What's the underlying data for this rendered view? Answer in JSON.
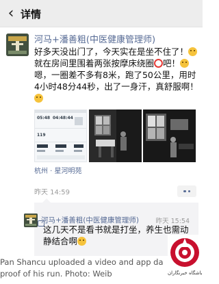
{
  "header": {
    "back_glyph": "‹",
    "title": "详情"
  },
  "post": {
    "author": "河马+潘善粗(中医健康管理师)",
    "text_1": "好多天没出门了，今天实在是坐不住了！",
    "text_2": "就在房间里围着两张按摩床绕圈",
    "text_3": "吧！",
    "text_4": "嗯，一圈差不多有8米，跑了50公里，用时4小时48分44秒，出了一身汗，真舒服啊！",
    "location": "杭州 · 星河明苑",
    "time": "昨天 14:59",
    "app_screenshot": {
      "stat_1": "05:48",
      "stat_2": "04:48:44",
      "stat_3": "119"
    }
  },
  "comment": {
    "author": "河马+潘善粗(中医健康管理师)",
    "time": "昨天 15:54",
    "text": "这几天不是看书就是打坐，养生也需动静结合啊"
  },
  "caption": {
    "line_1": "Pan Shancu uploaded a video and app da",
    "line_2": "proof of his run. Photo: Weib"
  },
  "watermark": {
    "text": "باشگاه خبرنگاران"
  }
}
